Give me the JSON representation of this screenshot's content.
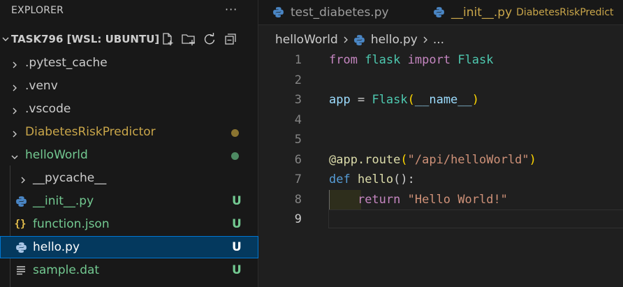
{
  "sidebar": {
    "header": "EXPLORER",
    "more": "···",
    "root": "TASK796 [WSL: UBUNTU]",
    "items": [
      {
        "label": ".pytest_cache",
        "color": "#cccccc",
        "status": ""
      },
      {
        "label": ".venv",
        "color": "#cccccc",
        "status": ""
      },
      {
        "label": ".vscode",
        "color": "#cccccc",
        "status": ""
      },
      {
        "label": "DiabetesRiskPredictor",
        "color": "#c9a64a",
        "status": "dot"
      },
      {
        "label": "helloWorld",
        "color": "#73c991",
        "status": "dot"
      },
      {
        "label": "__pycache__",
        "color": "#cccccc",
        "status": ""
      },
      {
        "label": "__init__.py",
        "color": "#73c991",
        "status": "U"
      },
      {
        "label": "function.json",
        "color": "#73c991",
        "status": "U"
      },
      {
        "label": "hello.py",
        "color": "#ffffff",
        "status": "U"
      },
      {
        "label": "sample.dat",
        "color": "#73c991",
        "status": "U"
      }
    ]
  },
  "tabs": [
    {
      "label": "test_diabetes.py",
      "desc": ""
    },
    {
      "label": "__init__.py",
      "desc": "DiabetesRiskPredict"
    }
  ],
  "breadcrumb": {
    "folder": "helloWorld",
    "file": "hello.py",
    "more": "..."
  },
  "code": {
    "line_numbers": [
      "1",
      "2",
      "3",
      "4",
      "5",
      "6",
      "7",
      "8",
      "9"
    ],
    "l1": {
      "a": "from",
      "b": "flask",
      "c": "import",
      "d": "Flask"
    },
    "l3": {
      "a": "app",
      "b": " = ",
      "c": "Flask",
      "d": "(",
      "e": "__name__",
      "f": ")"
    },
    "l6": {
      "a": "@",
      "b": "app",
      "c": ".",
      "d": "route",
      "e": "(",
      "f": "\"/api/helloWorld\"",
      "g": ")"
    },
    "l7": {
      "a": "def",
      "b": "hello",
      "c": "():"
    },
    "l8": {
      "a": "return",
      "b": "\"Hello World!\""
    }
  },
  "colors": {
    "accent": "#0078d4",
    "untracked": "#73c991",
    "modified": "#c9a64a"
  }
}
